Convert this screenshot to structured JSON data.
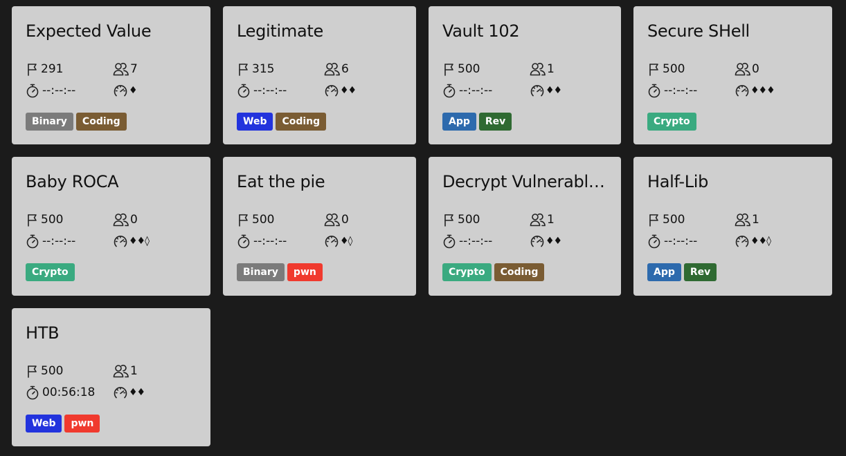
{
  "tag_colors": {
    "Binary": "#7b7b7b",
    "Coding": "#7a5c33",
    "Web": "#2233dd",
    "App": "#2d6aad",
    "Rev": "#2f6a32",
    "Crypto": "#3aaa80",
    "pwn": "#f03a2e"
  },
  "icons": {
    "points": "flag-icon",
    "solves": "users-icon",
    "time": "stopwatch-icon",
    "difficulty": "speedometer-icon"
  },
  "challenges": [
    {
      "title": "Expected Value",
      "points": "291",
      "solves": "7",
      "time": "--:--:--",
      "difficulty": "♦",
      "tags": [
        "Binary",
        "Coding"
      ]
    },
    {
      "title": "Legitimate",
      "points": "315",
      "solves": "6",
      "time": "--:--:--",
      "difficulty": "♦♦",
      "tags": [
        "Web",
        "Coding"
      ]
    },
    {
      "title": "Vault 102",
      "points": "500",
      "solves": "1",
      "time": "--:--:--",
      "difficulty": "♦♦",
      "tags": [
        "App",
        "Rev"
      ]
    },
    {
      "title": "Secure SHell",
      "points": "500",
      "solves": "0",
      "time": "--:--:--",
      "difficulty": "♦♦♦",
      "tags": [
        "Crypto"
      ]
    },
    {
      "title": "Baby ROCA",
      "points": "500",
      "solves": "0",
      "time": "--:--:--",
      "difficulty": "♦♦◊",
      "tags": [
        "Crypto"
      ]
    },
    {
      "title": "Eat the pie",
      "points": "500",
      "solves": "0",
      "time": "--:--:--",
      "difficulty": "♦◊",
      "tags": [
        "Binary",
        "pwn"
      ]
    },
    {
      "title": "Decrypt Vulnerable ...",
      "points": "500",
      "solves": "1",
      "time": "--:--:--",
      "difficulty": "♦♦",
      "tags": [
        "Crypto",
        "Coding"
      ]
    },
    {
      "title": "Half-Lib",
      "points": "500",
      "solves": "1",
      "time": "--:--:--",
      "difficulty": "♦♦◊",
      "tags": [
        "App",
        "Rev"
      ]
    },
    {
      "title": "HTB",
      "points": "500",
      "solves": "1",
      "time": "00:56:18",
      "difficulty": "♦♦",
      "tags": [
        "Web",
        "pwn"
      ]
    }
  ]
}
